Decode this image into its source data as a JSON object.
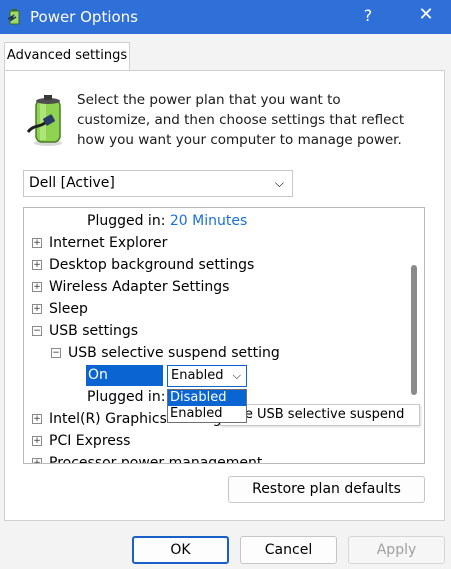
{
  "window": {
    "title": "Power Options"
  },
  "titlebar": {
    "help_glyph": "?",
    "close_glyph": "✕"
  },
  "tabs": [
    {
      "label": "Advanced settings"
    }
  ],
  "intro_text": "Select the power plan that you want to customize, and then choose settings that reflect how you want your computer to manage power.",
  "plan_select": {
    "value": "Dell [Active]"
  },
  "tree": {
    "plugged_in_top": {
      "label": "Plugged in:",
      "value": "20 Minutes"
    },
    "items": [
      {
        "label": "Internet Explorer",
        "expander": "+"
      },
      {
        "label": "Desktop background settings",
        "expander": "+"
      },
      {
        "label": "Wireless Adapter Settings",
        "expander": "+"
      },
      {
        "label": "Sleep",
        "expander": "+"
      },
      {
        "label": "USB settings",
        "expander": "−"
      },
      {
        "label": "USB selective suspend setting",
        "expander": "−"
      }
    ],
    "on_battery": {
      "label": "On battery:",
      "value": "Enabled"
    },
    "plugged_in_bottom": {
      "label": "Plugged in:"
    },
    "more_items": [
      {
        "label": "Intel(R) Graphics Settings",
        "expander": "+"
      },
      {
        "label": "PCI Express",
        "expander": "+"
      },
      {
        "label": "Processor power management",
        "expander": "+"
      }
    ]
  },
  "dropdown": {
    "options": [
      "Disabled",
      "Enabled"
    ],
    "highlighted": "Disabled"
  },
  "tooltip_text": "ble USB selective suspend",
  "buttons": {
    "restore": "Restore plan defaults",
    "ok": "OK",
    "cancel": "Cancel",
    "apply": "Apply"
  },
  "colors": {
    "accent": "#0a64d2",
    "link": "#1a6fd8",
    "titlebar": "#2f6fd8"
  },
  "icons": {
    "app": "power-options-icon",
    "battery": "battery-plug-icon"
  }
}
